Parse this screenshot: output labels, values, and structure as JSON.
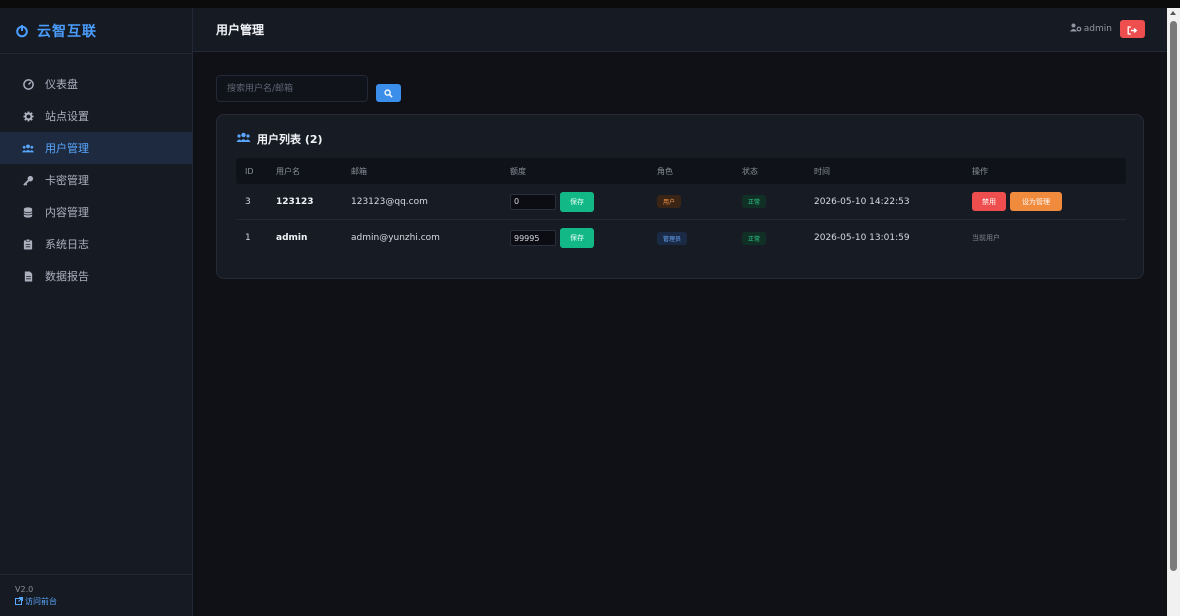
{
  "brand": {
    "title": "云智互联"
  },
  "sidebar": {
    "items": [
      {
        "label": "仪表盘",
        "icon": "dashboard-icon",
        "active": false
      },
      {
        "label": "站点设置",
        "icon": "gear-icon",
        "active": false
      },
      {
        "label": "用户管理",
        "icon": "users-icon",
        "active": true
      },
      {
        "label": "卡密管理",
        "icon": "key-icon",
        "active": false
      },
      {
        "label": "内容管理",
        "icon": "database-icon",
        "active": false
      },
      {
        "label": "系统日志",
        "icon": "clipboard-icon",
        "active": false
      },
      {
        "label": "数据报告",
        "icon": "file-icon",
        "active": false
      }
    ],
    "version": "V2.0",
    "site_link": "访问前台"
  },
  "header": {
    "title": "用户管理",
    "username": "admin"
  },
  "search": {
    "placeholder": "搜索用户名/邮箱",
    "value": ""
  },
  "card": {
    "title": "用户列表 (2)"
  },
  "table": {
    "columns": [
      "ID",
      "用户名",
      "邮箱",
      "额度",
      "角色",
      "状态",
      "时间",
      "操作"
    ],
    "rows": [
      {
        "id": "3",
        "username": "123123",
        "email": "123123@qq.com",
        "quota": "0",
        "save": "保存",
        "role": "用户",
        "status": "正常",
        "time": "2026-05-10 14:22:53",
        "op_ban": "禁用",
        "op_promote": "设为管理"
      },
      {
        "id": "1",
        "username": "admin",
        "email": "admin@yunzhi.com",
        "quota": "99995",
        "save": "保存",
        "role": "管理员",
        "status": "正常",
        "time": "2026-05-10 13:01:59",
        "op_text": "当前用户"
      }
    ]
  },
  "colors": {
    "accent": "#4a9eff",
    "success": "#12b886",
    "danger": "#ef4e4e",
    "warning": "#f08a3c"
  }
}
